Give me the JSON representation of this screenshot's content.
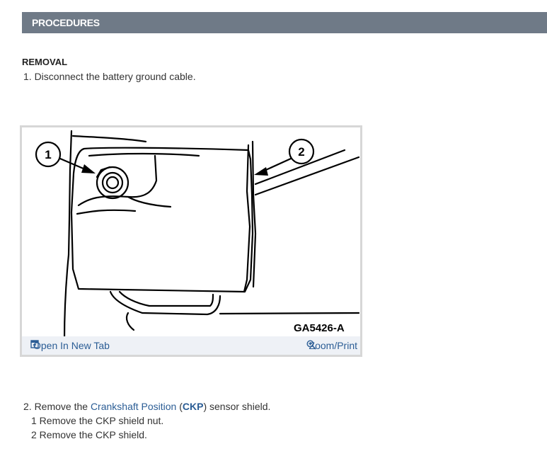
{
  "header": {
    "title": "PROCEDURES"
  },
  "section": {
    "title": "REMOVAL"
  },
  "steps": {
    "step1": "1. Disconnect the battery ground cable.",
    "step2_prefix": "2. Remove the ",
    "step2_link": "Crankshaft Position",
    "step2_open": " (",
    "step2_abbr": "CKP",
    "step2_suffix": ") sensor shield.",
    "substeps": [
      "1  Remove the CKP shield nut.",
      "2  Remove the CKP shield."
    ]
  },
  "figure": {
    "caption": "GA5426-A",
    "callout_1": "1",
    "callout_2": "2",
    "open_tab_label": "Open In New Tab",
    "zoom_label": "Zoom/Print"
  },
  "colors": {
    "header_bg": "#6f7a87",
    "link": "#2b5d95",
    "footer_bg": "#eef1f6"
  },
  "icons": {
    "open_tab": "new-tab-icon",
    "zoom": "zoom-in-icon"
  }
}
